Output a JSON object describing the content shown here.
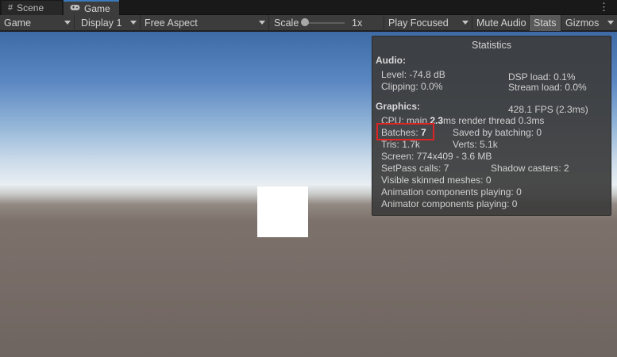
{
  "tabs": [
    {
      "icon": "grid-icon",
      "label": "Scene"
    },
    {
      "icon": "gamepad-icon",
      "label": "Game"
    }
  ],
  "toolbar": {
    "view_mode": "Game",
    "display": "Display 1",
    "aspect": "Free Aspect",
    "scale_label": "Scale",
    "scale_value": "1x",
    "play_mode": "Play Focused",
    "mute_audio": "Mute Audio",
    "stats": "Stats",
    "gizmos": "Gizmos"
  },
  "stats": {
    "title": "Statistics",
    "audio_header": "Audio:",
    "level": "Level: -74.8 dB",
    "clipping": "Clipping: 0.0%",
    "dsp_load": "DSP load: 0.1%",
    "stream_load": "Stream load: 0.0%",
    "graphics_header": "Graphics:",
    "fps": "428.1 FPS (2.3ms)",
    "cpu_prefix": "CPU: main ",
    "cpu_main": "2.3",
    "cpu_suffix": "ms  render thread 0.3ms",
    "batches_label": "Batches: ",
    "batches_value": "7",
    "saved_by_batching": "Saved by batching: 0",
    "tris": "Tris: 1.7k",
    "verts": "Verts: 5.1k",
    "screen": "Screen: 774x409 - 3.6 MB",
    "setpass": "SetPass calls: 7",
    "shadow_casters": "Shadow casters: 2",
    "skinned_meshes": "Visible skinned meshes: 0",
    "animation_components": "Animation components playing: 0",
    "animator_components": "Animator components playing: 0"
  },
  "colors": {
    "highlight": "#e02424",
    "tab_accent": "#3a79bb"
  }
}
